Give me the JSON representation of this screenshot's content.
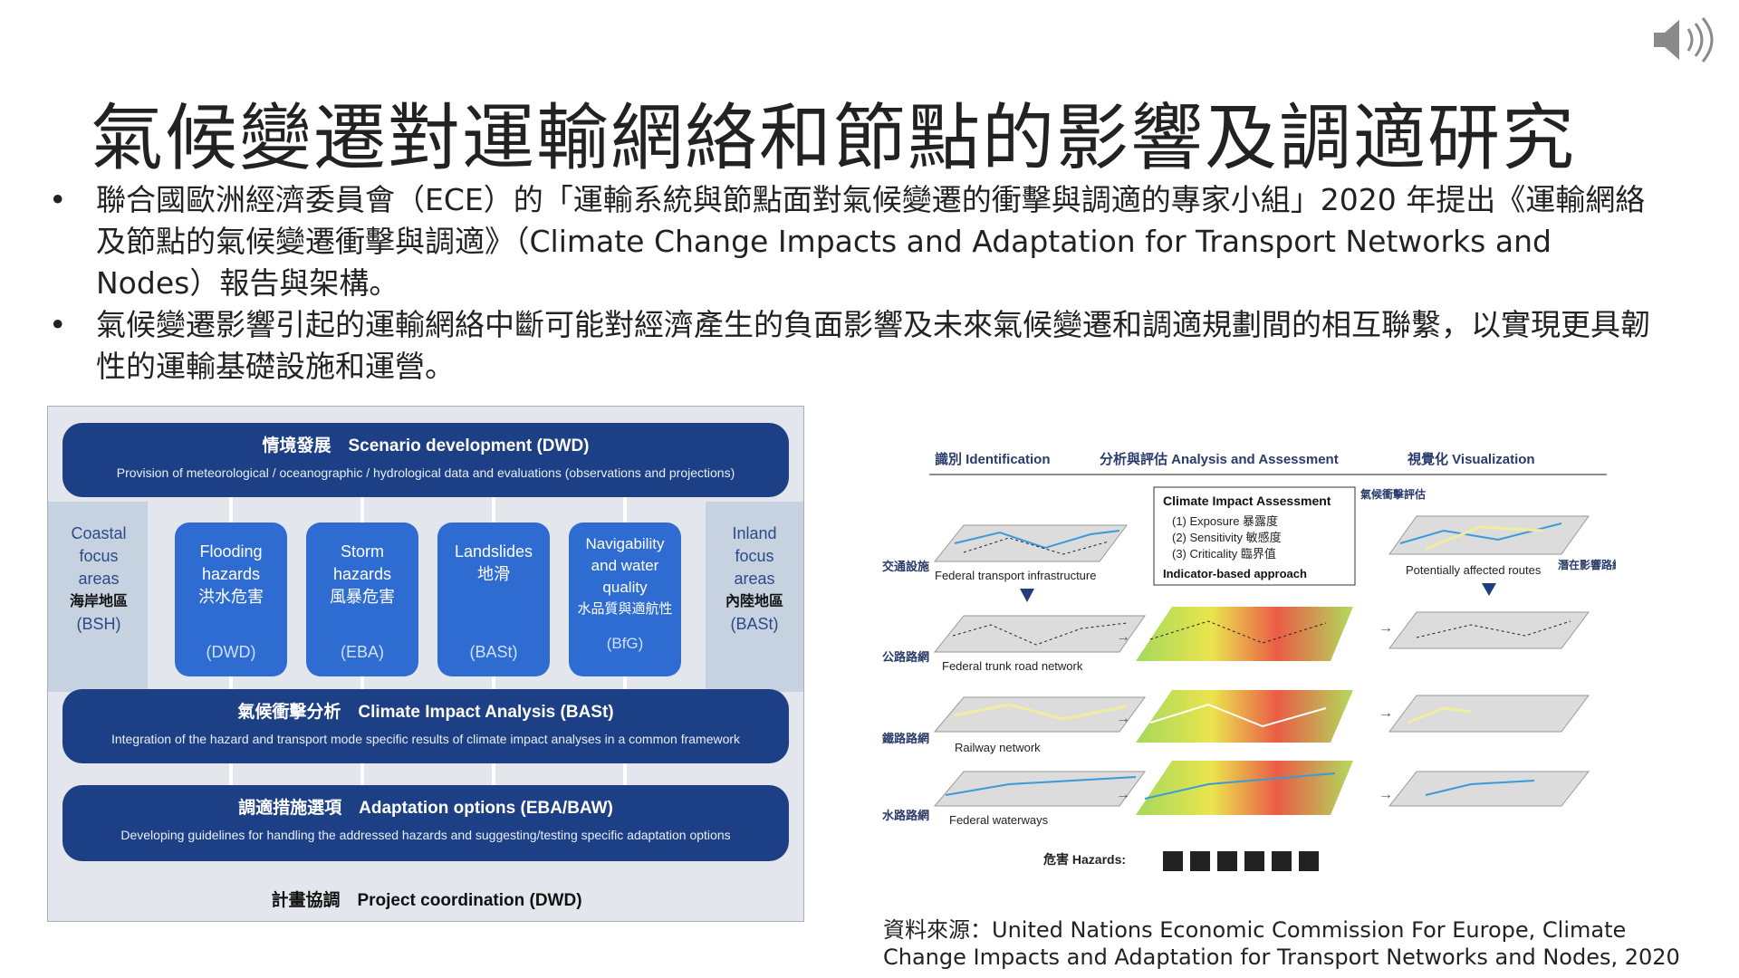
{
  "title": "氣候變遷對運輸網絡和節點的影響及調適研究",
  "bullets": [
    "聯合國歐洲經濟委員會（ECE）的「運輸系統與節點面對氣候變遷的衝擊與調適的專家小組」2020 年提出《運輸網絡及節點的氣候變遷衝擊與調適》（Climate Change Impacts and Adaptation for Transport Networks and Nodes）報告與架構。",
    "氣候變遷影響引起的運輸網絡中斷可能對經濟產生的負面影響及未來氣候變遷和調適規劃間的相互聯繫，以實現更具韌性的運輸基礎設施和運營。"
  ],
  "framework": {
    "scenario": {
      "title": "情境發展　Scenario development (DWD)",
      "subtitle": "Provision of meteorological / oceanographic / hydrological data and evaluations (observations and projections)"
    },
    "coastal": {
      "lines": [
        "Coastal",
        "focus",
        "areas"
      ],
      "zh": "海岸地區",
      "src": "(BSH)"
    },
    "inland": {
      "lines": [
        "Inland",
        "focus",
        "areas"
      ],
      "zh": "內陸地區",
      "src": "(BASt)"
    },
    "hazards": [
      {
        "lines": [
          "Flooding",
          "hazards",
          "洪水危害"
        ],
        "src": "(DWD)"
      },
      {
        "lines": [
          "Storm",
          "hazards",
          "風暴危害"
        ],
        "src": "(EBA)"
      },
      {
        "lines": [
          "Landslides",
          "地滑"
        ],
        "src": "(BASt)"
      },
      {
        "lines": [
          "Navigability",
          "and water",
          "quality",
          "水品質與適航性"
        ],
        "src": "(BfG)"
      }
    ],
    "impact": {
      "title": "氣候衝擊分析　Climate Impact Analysis (BASt)",
      "subtitle": "Integration of the hazard and transport mode specific results of climate impact analyses in a common framework"
    },
    "adaptation": {
      "title": "調適措施選項　Adaptation options (EBA/BAW)",
      "subtitle": "Developing guidelines for handling the addressed hazards and suggesting/testing specific adaptation options"
    },
    "coordination": "計畫協調　Project coordination (DWD)"
  },
  "diagram": {
    "headers": [
      "識別 Identification",
      "分析與評估 Analysis and Assessment",
      "視覺化 Visualization"
    ],
    "cia_title": "Climate Impact Assessment",
    "cia_items": [
      "(1) Exposure 暴露度",
      "(2) Sensitivity 敏感度",
      "(3) Criticality 臨界值"
    ],
    "cia_approach": "Indicator-based approach",
    "cia_side": "氣候衝擊評估",
    "left_labels": [
      "交通設施",
      "公路路網",
      "鐵路路網",
      "水路路網"
    ],
    "layer_labels": [
      "Federal transport infrastructure",
      "Federal trunk road network",
      "Railway network",
      "Federal waterways"
    ],
    "affected": "Potentially affected routes",
    "affected_zh": "潛在影響路線",
    "hazards_label": "危害 Hazards:"
  },
  "source": "資料來源：United Nations Economic Commission For Europe, Climate Change Impacts and Adaptation for Transport Networks and Nodes, 2020"
}
